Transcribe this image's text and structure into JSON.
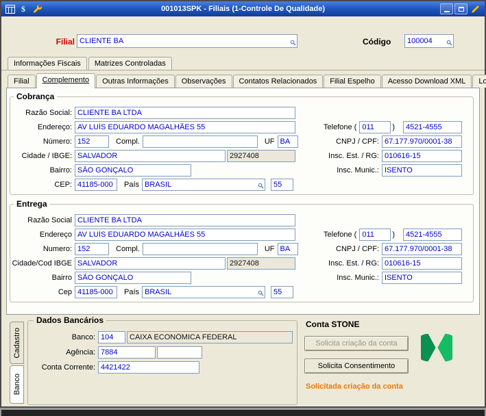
{
  "window": {
    "title": "001013SPK - Filiais (1-Controle De Qualidade)"
  },
  "header": {
    "filial_label": "Filial",
    "filial_value": "CLIENTE BA",
    "codigo_label": "Código",
    "codigo_value": "100004"
  },
  "top_tabs": [
    {
      "label": "Informações Fiscais"
    },
    {
      "label": "Matrizes Controladas"
    }
  ],
  "main_tabs": [
    {
      "label": "Filial"
    },
    {
      "label": "Complemento",
      "active": true
    },
    {
      "label": "Outras Informações"
    },
    {
      "label": "Observações"
    },
    {
      "label": "Contatos Relacionados"
    },
    {
      "label": "Filial Espelho"
    },
    {
      "label": "Acesso Download XML"
    },
    {
      "label": "Log"
    }
  ],
  "cobranca": {
    "title": "Cobrança",
    "labels": {
      "razao_social": "Razão Social:",
      "endereco": "Endereço:",
      "numero": "Número:",
      "compl": "Compl.",
      "uf": "UF",
      "cidade": "Cidade / IBGE:",
      "bairro": "Bairro:",
      "cep": "CEP:",
      "pais": "País",
      "telefone": "Telefone (",
      "telefone_close": ")",
      "cnpj": "CNPJ / CPF:",
      "insc_est": "Insc. Est. / RG:",
      "insc_munic": "Insc. Munic.:"
    },
    "values": {
      "razao_social": "CLIENTE BA LTDA",
      "endereco": "AV LUÍS EDUARDO MAGALHÃES 55",
      "numero": "152",
      "compl": "",
      "uf": "BA",
      "cidade": "SALVADOR",
      "ibge": "2927408",
      "bairro": "SÃO GONÇALO",
      "cep": "41185-000",
      "pais": "BRASIL",
      "pais_cod": "55",
      "ddd": "011",
      "telefone": "4521-4555",
      "cnpj": "67.177.970/0001-38",
      "insc_est": "010616-15",
      "insc_munic": "ISENTO"
    }
  },
  "entrega": {
    "title": "Entrega",
    "labels": {
      "razao_social": "Razão Social",
      "endereco": "Endereço",
      "numero": "Numero:",
      "compl": "Compl.",
      "uf": "UF",
      "cidade": "Cidade/Cod IBGE",
      "bairro": "Bairro",
      "cep": "Cep",
      "pais": "País",
      "telefone": "Telefone (",
      "telefone_close": ")",
      "cnpj": "CNPJ / CPF:",
      "insc_est": "Insc. Est. / RG:",
      "insc_munic": "Insc. Munic.:"
    },
    "values": {
      "razao_social": "CLIENTE BA LTDA",
      "endereco": "AV LUÍS EDUARDO MAGALHÃES 55",
      "numero": "152",
      "compl": "",
      "uf": "BA",
      "cidade": "SALVADOR",
      "ibge": "2927408",
      "bairro": "SÃO GONÇALO",
      "cep": "41185-000",
      "pais": "BRASIL",
      "pais_cod": "55",
      "ddd": "011",
      "telefone": "4521-4555",
      "cnpj": "67.177.970/0001-38",
      "insc_est": "010616-15",
      "insc_munic": "ISENTO"
    }
  },
  "bottom": {
    "side_tabs": [
      {
        "label": "Cadastro"
      },
      {
        "label": "Banco",
        "active": true
      }
    ],
    "dados_bancarios": {
      "title": "Dados Bancários",
      "banco_label": "Banco:",
      "banco_cod": "104",
      "banco_nome": "CAIXA ECONÔMICA FEDERAL",
      "agencia_label": "Agência:",
      "agencia": "7884",
      "agencia_digito": "",
      "conta_label": "Conta Corrente:",
      "conta": "4421422"
    },
    "conta_stone": {
      "title": "Conta STONE",
      "btn_solicita_criacao": "Solicita criação da conta",
      "btn_solicita_consentimento": "Solicita Consentimento",
      "status": "Solicitada criação da conta"
    }
  },
  "icons": {
    "titlebar": [
      "app-grid-icon",
      "money-icon",
      "wrench-icon"
    ],
    "controls": [
      "minimize-icon",
      "maximize-icon",
      "edit-pencil-icon"
    ],
    "field_lookup": "magnifier-icon",
    "stone": "stone-logo"
  },
  "colors": {
    "input_text": "#0000d0",
    "filial_label": "#d40000",
    "status_orange": "#f07800",
    "stone_green_dark": "#0a9050",
    "stone_green_light": "#14bc62",
    "titlebar_blue": "#1e4fb0",
    "readonly_bg": "#ebe8da"
  }
}
